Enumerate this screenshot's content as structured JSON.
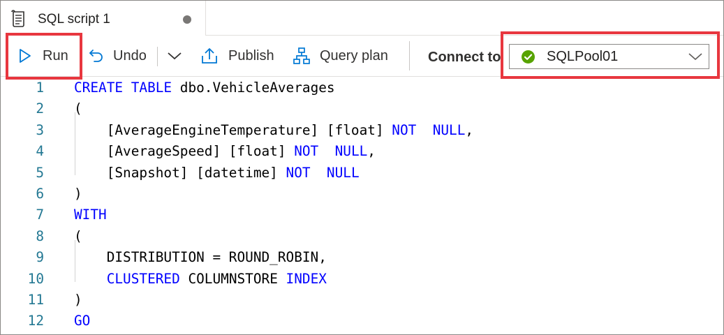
{
  "tab": {
    "title": "SQL script 1",
    "icon": "script-icon",
    "modified_indicator": "unsaved-dot"
  },
  "toolbar": {
    "run_label": "Run",
    "undo_label": "Undo",
    "publish_label": "Publish",
    "query_plan_label": "Query plan",
    "connect_to_label": "Connect to",
    "pool": {
      "value": "SQLPool01",
      "status": "connected",
      "status_color": "#57a300"
    },
    "highlight_color": "#e8373f"
  },
  "editor": {
    "lines": [
      {
        "num": "1",
        "tokens": [
          {
            "t": "CREATE",
            "k": true
          },
          {
            "t": " ",
            "k": false
          },
          {
            "t": "TABLE",
            "k": true
          },
          {
            "t": " dbo.VehicleAverages",
            "k": false
          }
        ]
      },
      {
        "num": "2",
        "tokens": [
          {
            "t": "(",
            "k": false
          }
        ]
      },
      {
        "num": "3",
        "tokens": [
          {
            "t": "    [AverageEngineTemperature] [float] ",
            "k": false
          },
          {
            "t": "NOT",
            "k": true
          },
          {
            "t": "  ",
            "k": false
          },
          {
            "t": "NULL",
            "k": true
          },
          {
            "t": ",",
            "k": false
          }
        ]
      },
      {
        "num": "4",
        "tokens": [
          {
            "t": "    [AverageSpeed] [float] ",
            "k": false
          },
          {
            "t": "NOT",
            "k": true
          },
          {
            "t": "  ",
            "k": false
          },
          {
            "t": "NULL",
            "k": true
          },
          {
            "t": ",",
            "k": false
          }
        ]
      },
      {
        "num": "5",
        "tokens": [
          {
            "t": "    [Snapshot] [datetime] ",
            "k": false
          },
          {
            "t": "NOT",
            "k": true
          },
          {
            "t": "  ",
            "k": false
          },
          {
            "t": "NULL",
            "k": true
          }
        ]
      },
      {
        "num": "6",
        "tokens": [
          {
            "t": ")",
            "k": false
          }
        ]
      },
      {
        "num": "7",
        "tokens": [
          {
            "t": "WITH",
            "k": true
          }
        ]
      },
      {
        "num": "8",
        "tokens": [
          {
            "t": "(",
            "k": false
          }
        ]
      },
      {
        "num": "9",
        "tokens": [
          {
            "t": "    DISTRIBUTION = ROUND_ROBIN,",
            "k": false
          }
        ]
      },
      {
        "num": "10",
        "tokens": [
          {
            "t": "    ",
            "k": false
          },
          {
            "t": "CLUSTERED",
            "k": true
          },
          {
            "t": " COLUMNSTORE ",
            "k": false
          },
          {
            "t": "INDEX",
            "k": true
          }
        ]
      },
      {
        "num": "11",
        "tokens": [
          {
            "t": ")",
            "k": false
          }
        ]
      },
      {
        "num": "12",
        "tokens": [
          {
            "t": "GO",
            "k": true
          }
        ]
      }
    ],
    "keyword_color": "#0000ff",
    "line_number_color": "#237893"
  }
}
